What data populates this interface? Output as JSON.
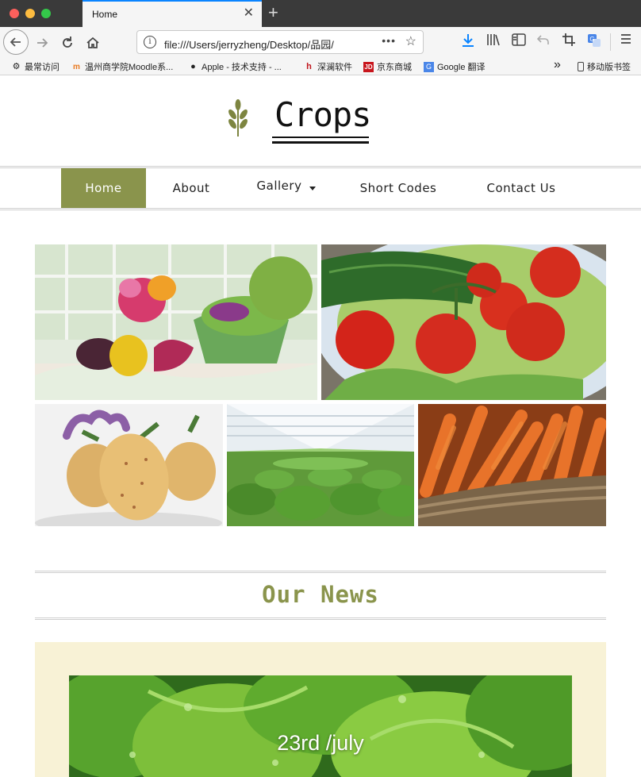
{
  "browser": {
    "tab_title": "Home",
    "url": "file:///Users/jerryzheng/Desktop/品园/",
    "bookmarks": [
      {
        "label": "最常访问",
        "icon": "gear-icon"
      },
      {
        "label": "温州商学院Moodle系...",
        "icon": "moodle-icon"
      },
      {
        "label": "Apple - 技术支持 - ...",
        "icon": "apple-icon"
      },
      {
        "label": "深澜软件",
        "icon": "srun-icon"
      },
      {
        "label": "京东商城",
        "icon": "jd-icon"
      },
      {
        "label": "Google 翻译",
        "icon": "google-translate-icon"
      }
    ],
    "overflow_label": "»",
    "mobile_bookmarks": "移动版书签"
  },
  "site": {
    "logo_text": "Crops",
    "menu": [
      {
        "label": "Home",
        "active": true
      },
      {
        "label": "About",
        "active": false
      },
      {
        "label": "Gallery",
        "active": false,
        "dropdown": true
      },
      {
        "label": "Short Codes",
        "active": false
      },
      {
        "label": "Contact Us",
        "active": false
      }
    ],
    "gallery": [
      {
        "subject": "vegetables-on-table"
      },
      {
        "subject": "tomatoes-cucumber-bowl"
      },
      {
        "subject": "potatoes"
      },
      {
        "subject": "greenhouse-lettuce"
      },
      {
        "subject": "carrots-basket"
      }
    ],
    "news_title": "Our News",
    "news_date": "23rd /july"
  },
  "colors": {
    "accent": "#8a944c",
    "news_bg": "#f8f2d6",
    "tab_active": "#0a84ff"
  }
}
